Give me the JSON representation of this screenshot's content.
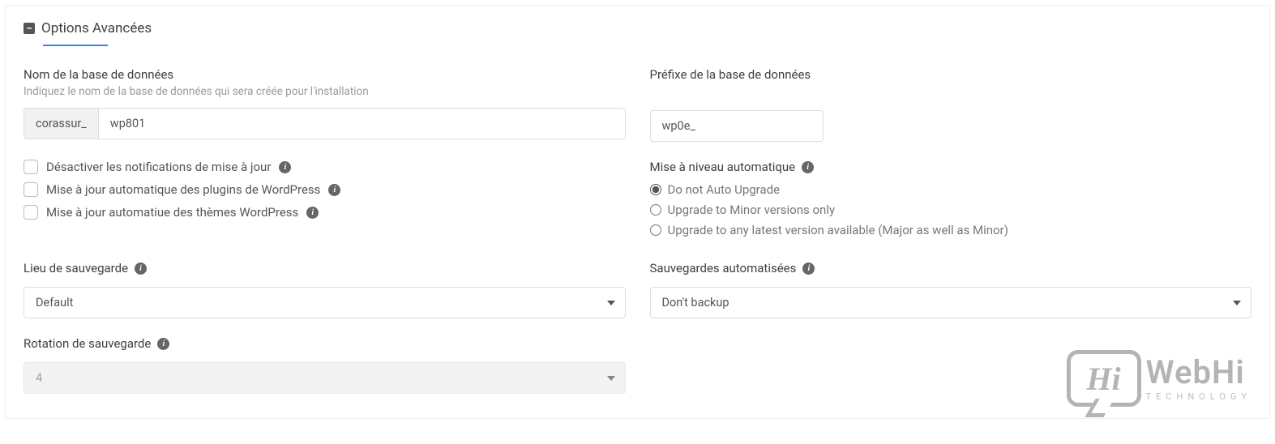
{
  "section": {
    "title": "Options Avancées"
  },
  "db_name": {
    "label": "Nom de la base de données",
    "help": "Indiquez le nom de la base de données qui sera créée pour l'installation",
    "prefix": "corassur_",
    "value": "wp801"
  },
  "db_prefix": {
    "label": "Préfixe de la base de données",
    "value": "wp0e_"
  },
  "checks": {
    "disable_update": "Désactiver les notifications de mise à jour",
    "auto_plugins": "Mise à jour automatique des plugins de WordPress",
    "auto_themes": "Mise à jour automatiue des thèmes WordPress"
  },
  "auto_upgrade": {
    "label": "Mise à niveau automatique",
    "opt_none": "Do not Auto Upgrade",
    "opt_minor": "Upgrade to Minor versions only",
    "opt_major": "Upgrade to any latest version available (Major as well as Minor)"
  },
  "backup_loc": {
    "label": "Lieu de sauvegarde",
    "value": "Default"
  },
  "auto_backups": {
    "label": "Sauvegardes automatisées",
    "value": "Don't backup"
  },
  "rotation": {
    "label": "Rotation de sauvegarde",
    "value": "4"
  },
  "watermark": {
    "hi": "Hi",
    "main": "WebHi",
    "sub": "TECHNOLOGY"
  }
}
